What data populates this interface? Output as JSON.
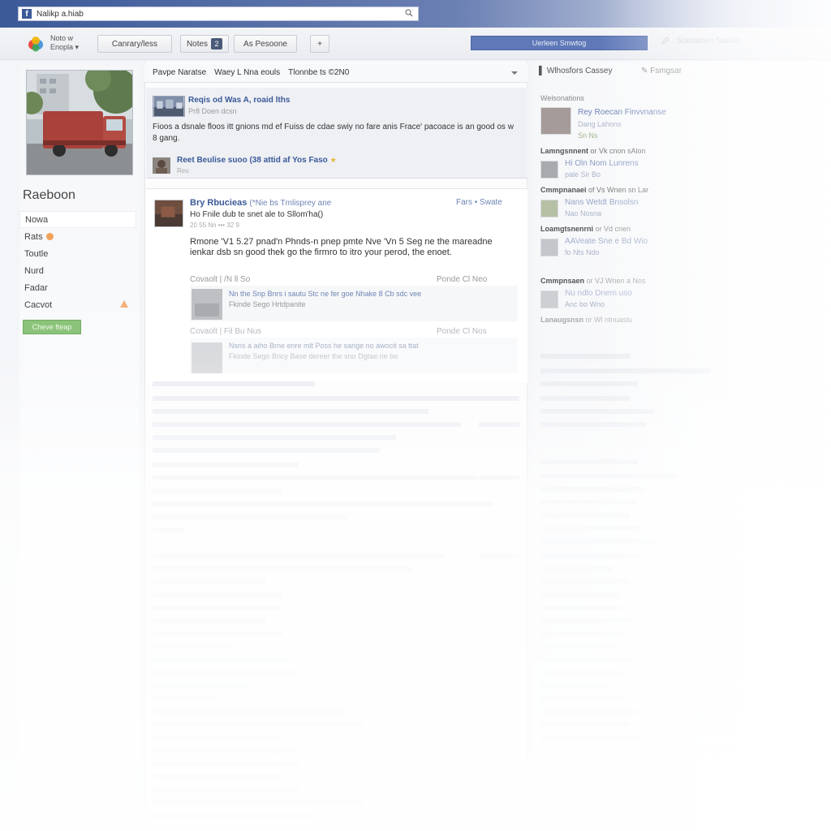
{
  "browser": {
    "address": "Nalikp a.hiab",
    "favicon_letter": "f"
  },
  "toolbar": {
    "user_line1": "Noto w",
    "user_line2": "Enopla",
    "btn_company": "Canrary/less",
    "btn_notes": "Notes",
    "btn_notes_badge": "2",
    "btn_profile": "As Pesoone",
    "btn_plus": "+",
    "search_placeholder": "Uerleen Smwtog",
    "right_text": "Sotmanen Sanlos"
  },
  "profile": {
    "name": "Raeboon"
  },
  "nav": {
    "items": [
      {
        "label": "Nowa"
      },
      {
        "label": "Rats"
      },
      {
        "label": "Toutle"
      },
      {
        "label": "Nurd"
      },
      {
        "label": "Fadar"
      },
      {
        "label": "Cacvot"
      }
    ],
    "button": "Cheve fteap"
  },
  "filter": {
    "a": "Pavpe Naratse",
    "b": "Waey L Nna eouls",
    "c": "Tlonnbe ts ©2N0"
  },
  "post1": {
    "title": "Reqis od Was A, roaid lths",
    "subtitle": "Pr8 Doen dcsn",
    "body": "Fioos a dsnale floos itt gnions md ef Fuiss de cdae swiy no fare anis Frace' pacoace is an good os w 8 gang.",
    "share_title": "Reet Beulise suoo (38 attid af Yos Faso",
    "share_sub": "Reu"
  },
  "post2": {
    "name": "Bry Rbucieas",
    "name_suffix": "(*Nie bs Tmlisprey ane",
    "line2": "Ho Fnile dub te snet ale to Sllom'ha()",
    "time": "20 55 Nn    ••• 32 9",
    "actions": "Fars • Swate",
    "body": "Rmone 'V1 5.27 pnad'n Phnds-n pnep pmte Nve 'Vn 5 Seg ne the mareadne ienkar dsb sn good thek go the firmro to itro your perod, the enoet.",
    "meta_left": "Covaolt  |  /N ll  So",
    "meta_right": "Ponde Cl Neo",
    "comment1": "Nn the Snp Bnrs i sautu Stc ne fer goe Nhake 8 Cb sdc vee",
    "comment1_sub": "Fkinde Sego Hrtdpanite",
    "meta2_left": "Covaolt  |  Fil Bu Nus",
    "meta2_right": "Ponde Cl Nos",
    "comment2": "Nsns a aiho Brne enre mlt Poss he sange no awocit sa ttat",
    "comment2_sub": "Fkinde Sego Bncy Base dereer the sno Dgtae ne bo"
  },
  "right": {
    "header1": "Wlhosfors Cassey",
    "header2": "Fsmgsar",
    "section": "Welsonations",
    "items": [
      {
        "title": "Rey Roecan Finvvnanse",
        "sub": "Dang Lahons",
        "sub2": "Sn Ns"
      },
      {
        "group": "Lamngsnnent",
        "rest": "or  Vk cnon sAlon"
      },
      {
        "title": "Hi Oln Nom Lunrens",
        "sub": "pale Sir Bo"
      },
      {
        "group": "Cmmpnanaei",
        "rest": "of Vs Wnen sn Lar"
      },
      {
        "title": "Nans Wetdt Bnsolsn",
        "sub": "Nao Nosna"
      },
      {
        "group": "Loamgtsnenrni",
        "rest": "or  Vd cnen"
      },
      {
        "title": "AAVeate Sne e Bd Wio",
        "sub": "fo Nts Ndo"
      },
      {
        "group": "Cmmpnsaen",
        "rest": "or  VJ Wnen a Nos"
      },
      {
        "title": "Nu ndlo Dnem uso",
        "sub": "Anc bo Wno"
      },
      {
        "group": "Lanaugsnsn",
        "rest": "or  Wl ntnuaslu"
      }
    ]
  },
  "colors": {
    "fb_blue": "#3b5998",
    "link_blue": "#6d84b4",
    "green_button": "#8cc37a"
  }
}
